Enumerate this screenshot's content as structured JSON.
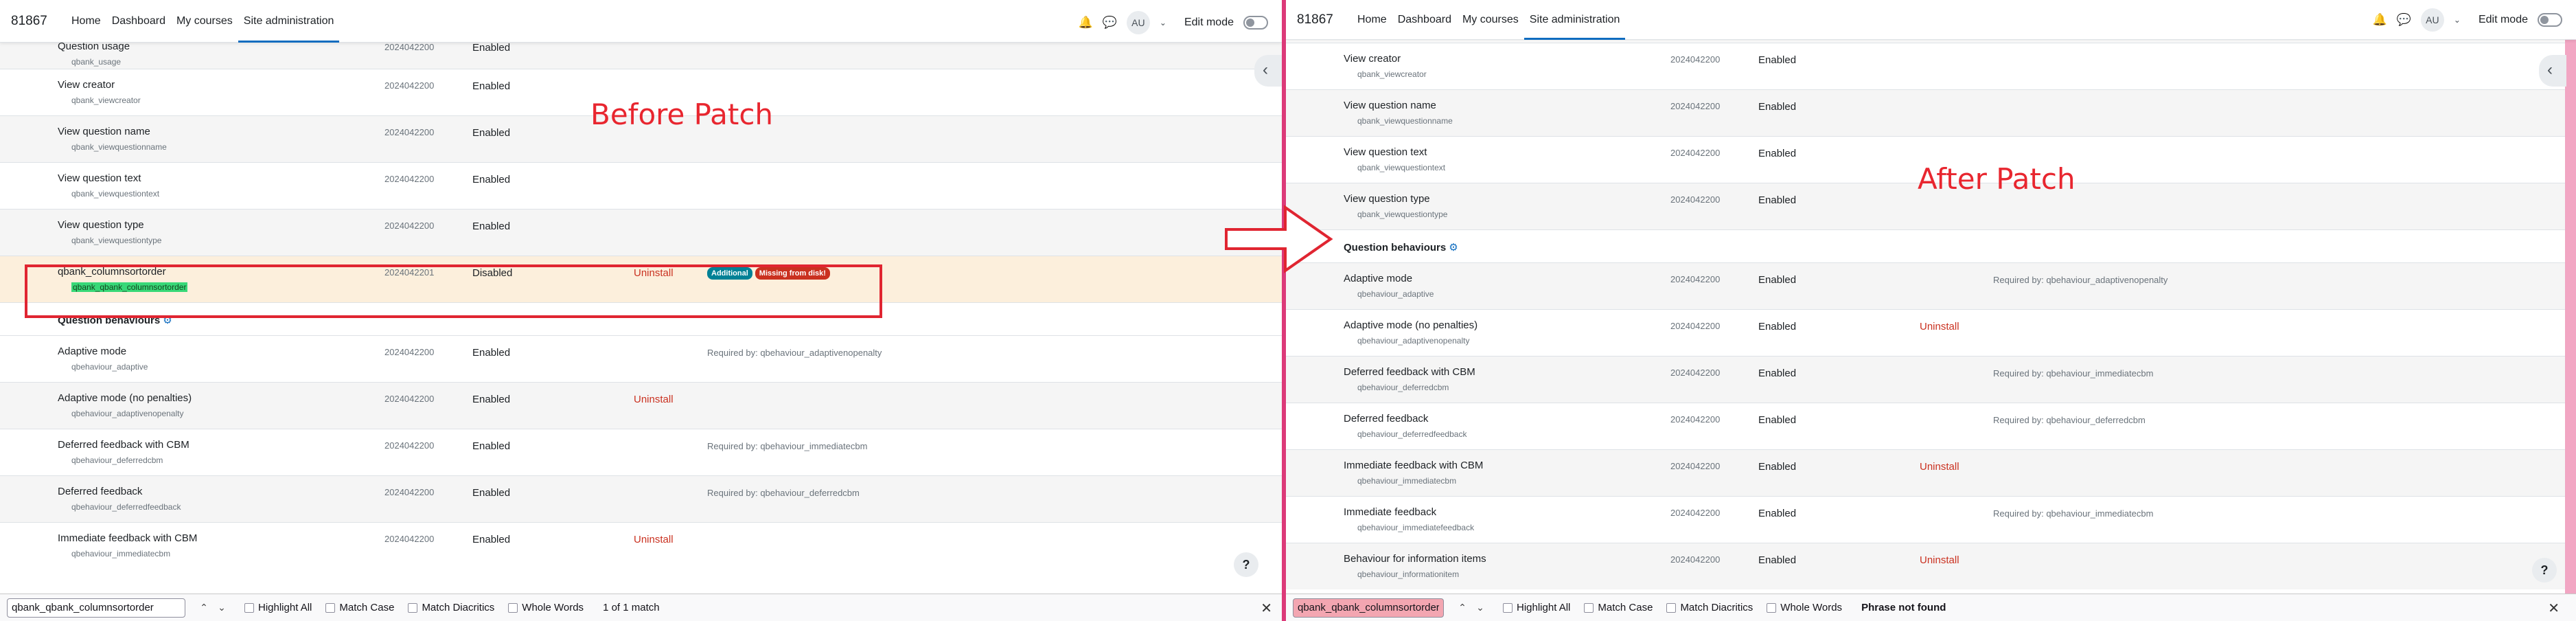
{
  "left": {
    "brand": "81867",
    "nav": [
      "Home",
      "Dashboard",
      "My courses",
      "Site administration"
    ],
    "avatar": "AU",
    "edit_mode": "Edit mode",
    "annotation": "Before Patch",
    "rows": [
      {
        "name": "Question usage",
        "component": "qbank_usage",
        "version": "2024042200",
        "status": "Enabled",
        "uninstall": "",
        "notes": ""
      },
      {
        "name": "View creator",
        "component": "qbank_viewcreator",
        "version": "2024042200",
        "status": "Enabled",
        "uninstall": "",
        "notes": ""
      },
      {
        "name": "View question name",
        "component": "qbank_viewquestionname",
        "version": "2024042200",
        "status": "Enabled",
        "uninstall": "",
        "notes": ""
      },
      {
        "name": "View question text",
        "component": "qbank_viewquestiontext",
        "version": "2024042200",
        "status": "Enabled",
        "uninstall": "",
        "notes": ""
      },
      {
        "name": "View question type",
        "component": "qbank_viewquestiontype",
        "version": "2024042200",
        "status": "Enabled",
        "uninstall": "",
        "notes": ""
      },
      {
        "name": "qbank_columnsortorder",
        "component": "qbank_qbank_columnsortorder",
        "version": "2024042201",
        "status": "Disabled",
        "uninstall": "Uninstall",
        "notes": "",
        "badges": [
          "Additional",
          "Missing from disk!"
        ]
      }
    ],
    "section_title": "Question behaviours",
    "section_rows": [
      {
        "name": "Adaptive mode",
        "component": "qbehaviour_adaptive",
        "version": "2024042200",
        "status": "Enabled",
        "uninstall": "",
        "notes": "Required by: qbehaviour_adaptivenopenalty"
      },
      {
        "name": "Adaptive mode (no penalties)",
        "component": "qbehaviour_adaptivenopenalty",
        "version": "2024042200",
        "status": "Enabled",
        "uninstall": "Uninstall",
        "notes": ""
      },
      {
        "name": "Deferred feedback with CBM",
        "component": "qbehaviour_deferredcbm",
        "version": "2024042200",
        "status": "Enabled",
        "uninstall": "",
        "notes": "Required by: qbehaviour_immediatecbm"
      },
      {
        "name": "Deferred feedback",
        "component": "qbehaviour_deferredfeedback",
        "version": "2024042200",
        "status": "Enabled",
        "uninstall": "",
        "notes": "Required by: qbehaviour_deferredcbm"
      },
      {
        "name": "Immediate feedback with CBM",
        "component": "qbehaviour_immediatecbm",
        "version": "2024042200",
        "status": "Enabled",
        "uninstall": "Uninstall",
        "notes": ""
      }
    ],
    "find": {
      "query": "qbank_qbank_columnsortorder",
      "highlight_all": "Highlight All",
      "match_case": "Match Case",
      "match_diacritics": "Match Diacritics",
      "whole_words": "Whole Words",
      "status": "1 of 1 match"
    }
  },
  "right": {
    "brand": "81867",
    "nav": [
      "Home",
      "Dashboard",
      "My courses",
      "Site administration"
    ],
    "avatar": "AU",
    "edit_mode": "Edit mode",
    "annotation": "After Patch",
    "rows": [
      {
        "name": "View creator",
        "component": "qbank_viewcreator",
        "version": "2024042200",
        "status": "Enabled",
        "uninstall": "",
        "notes": ""
      },
      {
        "name": "View question name",
        "component": "qbank_viewquestionname",
        "version": "2024042200",
        "status": "Enabled",
        "uninstall": "",
        "notes": ""
      },
      {
        "name": "View question text",
        "component": "qbank_viewquestiontext",
        "version": "2024042200",
        "status": "Enabled",
        "uninstall": "",
        "notes": ""
      },
      {
        "name": "View question type",
        "component": "qbank_viewquestiontype",
        "version": "2024042200",
        "status": "Enabled",
        "uninstall": "",
        "notes": ""
      }
    ],
    "section_title": "Question behaviours",
    "section_rows": [
      {
        "name": "Adaptive mode",
        "component": "qbehaviour_adaptive",
        "version": "2024042200",
        "status": "Enabled",
        "uninstall": "",
        "notes": "Required by: qbehaviour_adaptivenopenalty"
      },
      {
        "name": "Adaptive mode (no penalties)",
        "component": "qbehaviour_adaptivenopenalty",
        "version": "2024042200",
        "status": "Enabled",
        "uninstall": "Uninstall",
        "notes": ""
      },
      {
        "name": "Deferred feedback with CBM",
        "component": "qbehaviour_deferredcbm",
        "version": "2024042200",
        "status": "Enabled",
        "uninstall": "",
        "notes": "Required by: qbehaviour_immediatecbm"
      },
      {
        "name": "Deferred feedback",
        "component": "qbehaviour_deferredfeedback",
        "version": "2024042200",
        "status": "Enabled",
        "uninstall": "",
        "notes": "Required by: qbehaviour_deferredcbm"
      },
      {
        "name": "Immediate feedback with CBM",
        "component": "qbehaviour_immediatecbm",
        "version": "2024042200",
        "status": "Enabled",
        "uninstall": "Uninstall",
        "notes": ""
      },
      {
        "name": "Immediate feedback",
        "component": "qbehaviour_immediatefeedback",
        "version": "2024042200",
        "status": "Enabled",
        "uninstall": "",
        "notes": "Required by: qbehaviour_immediatecbm"
      },
      {
        "name": "Behaviour for information items",
        "component": "qbehaviour_informationitem",
        "version": "2024042200",
        "status": "Enabled",
        "uninstall": "Uninstall",
        "notes": ""
      }
    ],
    "find": {
      "query": "qbank_qbank_columnsortorder",
      "highlight_all": "Highlight All",
      "match_case": "Match Case",
      "match_diacritics": "Match Diacritics",
      "whole_words": "Whole Words",
      "status": "Phrase not found"
    }
  },
  "icons": {
    "bell": "bell-icon",
    "chat": "chat-icon",
    "gear": "gear-icon",
    "drawer": "chevron-left-icon",
    "help": "question-mark-icon",
    "arrow": "right-arrow-icon"
  },
  "colors": {
    "accent": "#0f6cbf",
    "danger": "#ca3120",
    "annotation": "#e8262f",
    "highlight_row": "#fcefdc",
    "match": "#38d878",
    "not_found": "#f3a6b1"
  }
}
